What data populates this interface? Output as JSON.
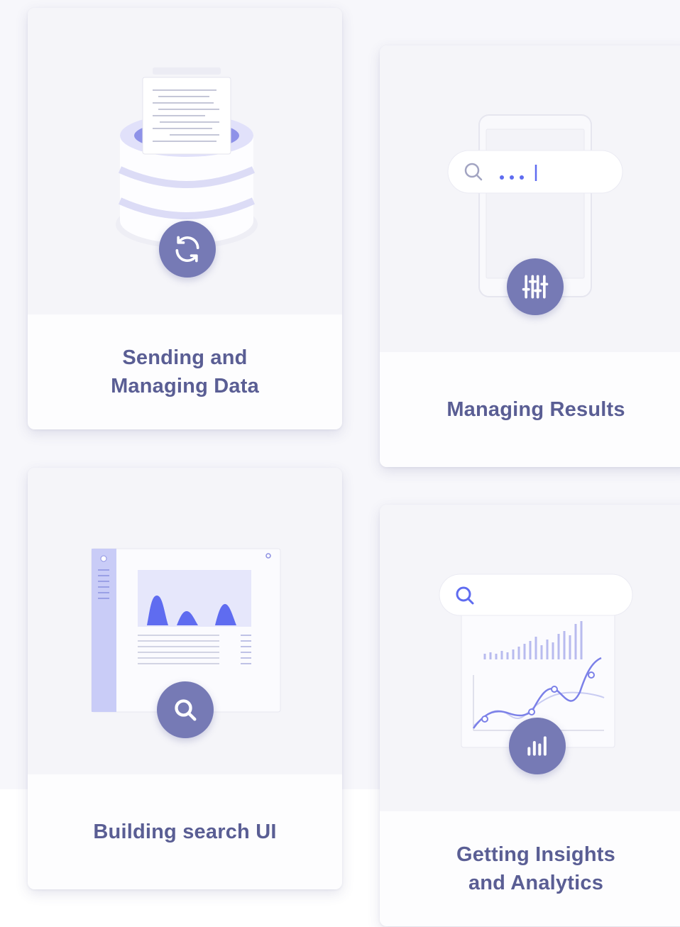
{
  "cards": [
    {
      "title": "Sending and\nManaging Data",
      "icon": "sync-icon"
    },
    {
      "title": "Managing Results",
      "icon": "sliders-icon"
    },
    {
      "title": "Building search UI",
      "icon": "search-icon"
    },
    {
      "title": "Getting Insights\nand Analytics",
      "icon": "bar-chart-icon"
    }
  ],
  "colors": {
    "accent": "#767ab5",
    "text": "#5a5e94",
    "highlight": "#5f6cf0"
  }
}
